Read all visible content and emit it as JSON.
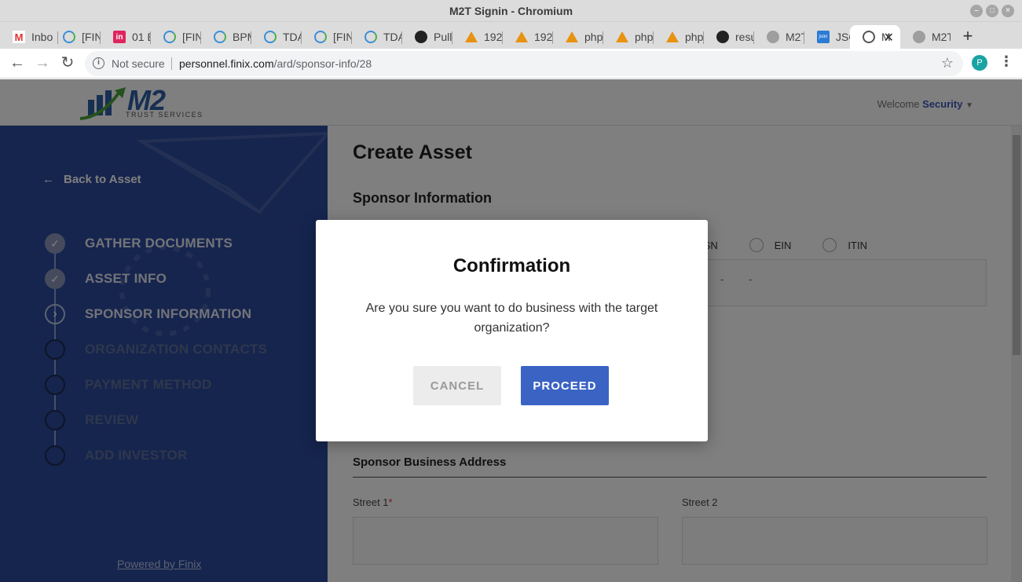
{
  "window": {
    "title": "M2T Signin - Chromium"
  },
  "tabs": [
    {
      "label": "Inbo",
      "icon": "gmail-icon"
    },
    {
      "label": "[FIN",
      "icon": "loading-icon"
    },
    {
      "label": "01 E",
      "icon": "invision-icon"
    },
    {
      "label": "[FIN",
      "icon": "loading-icon"
    },
    {
      "label": "BPM",
      "icon": "loading-icon"
    },
    {
      "label": "TDA",
      "icon": "loading-icon"
    },
    {
      "label": "[FIN",
      "icon": "loading-icon"
    },
    {
      "label": "TDA",
      "icon": "loading-icon"
    },
    {
      "label": "Pull",
      "icon": "github-icon"
    },
    {
      "label": "192",
      "icon": "sailboat-icon"
    },
    {
      "label": "192",
      "icon": "sailboat-icon"
    },
    {
      "label": "php",
      "icon": "sailboat-icon"
    },
    {
      "label": "php",
      "icon": "sailboat-icon"
    },
    {
      "label": "php",
      "icon": "sailboat-icon"
    },
    {
      "label": "resu",
      "icon": "github-icon"
    },
    {
      "label": "M2T",
      "icon": "globe-grey-icon"
    },
    {
      "label": "JSO",
      "icon": "json-icon"
    },
    {
      "label": "M",
      "icon": "globe-icon",
      "active": true
    },
    {
      "label": "M2T",
      "icon": "globe-grey-icon"
    }
  ],
  "address_bar": {
    "security": "Not secure",
    "host": "personnel.finix.com",
    "path": "/ard/sponsor-info/28"
  },
  "profile_initial": "P",
  "header": {
    "logo_text": "M2",
    "logo_subtext": "TRUST SERVICES",
    "welcome": "Welcome",
    "user": "Security"
  },
  "sidebar": {
    "back_label": "Back to Asset",
    "steps": [
      {
        "label": "GATHER DOCUMENTS",
        "state": "done"
      },
      {
        "label": "ASSET INFO",
        "state": "done"
      },
      {
        "label": "SPONSOR INFORMATION",
        "state": "current"
      },
      {
        "label": "ORGANIZATION CONTACTS",
        "state": "todo"
      },
      {
        "label": "PAYMENT METHOD",
        "state": "todo"
      },
      {
        "label": "REVIEW",
        "state": "todo"
      },
      {
        "label": "ADD INVESTOR",
        "state": "todo"
      }
    ],
    "powered_by": "Powered by Finix"
  },
  "main": {
    "page_title": "Create Asset",
    "section_title": "Sponsor Information",
    "tax_options": [
      "SSN",
      "EIN",
      "ITIN"
    ],
    "tax_dash": "-",
    "address_title": "Sponsor Business Address",
    "street1_label": "Street 1",
    "street1_required": "*",
    "street2_label": "Street 2"
  },
  "modal": {
    "title": "Confirmation",
    "message": "Are you sure you want to do business with the target organization?",
    "cancel_label": "CANCEL",
    "proceed_label": "PROCEED"
  },
  "colors": {
    "sidebar": "#2d4a9c",
    "primary_button": "#3a63c4",
    "overlay": "rgba(0,0,0,0.5)"
  }
}
